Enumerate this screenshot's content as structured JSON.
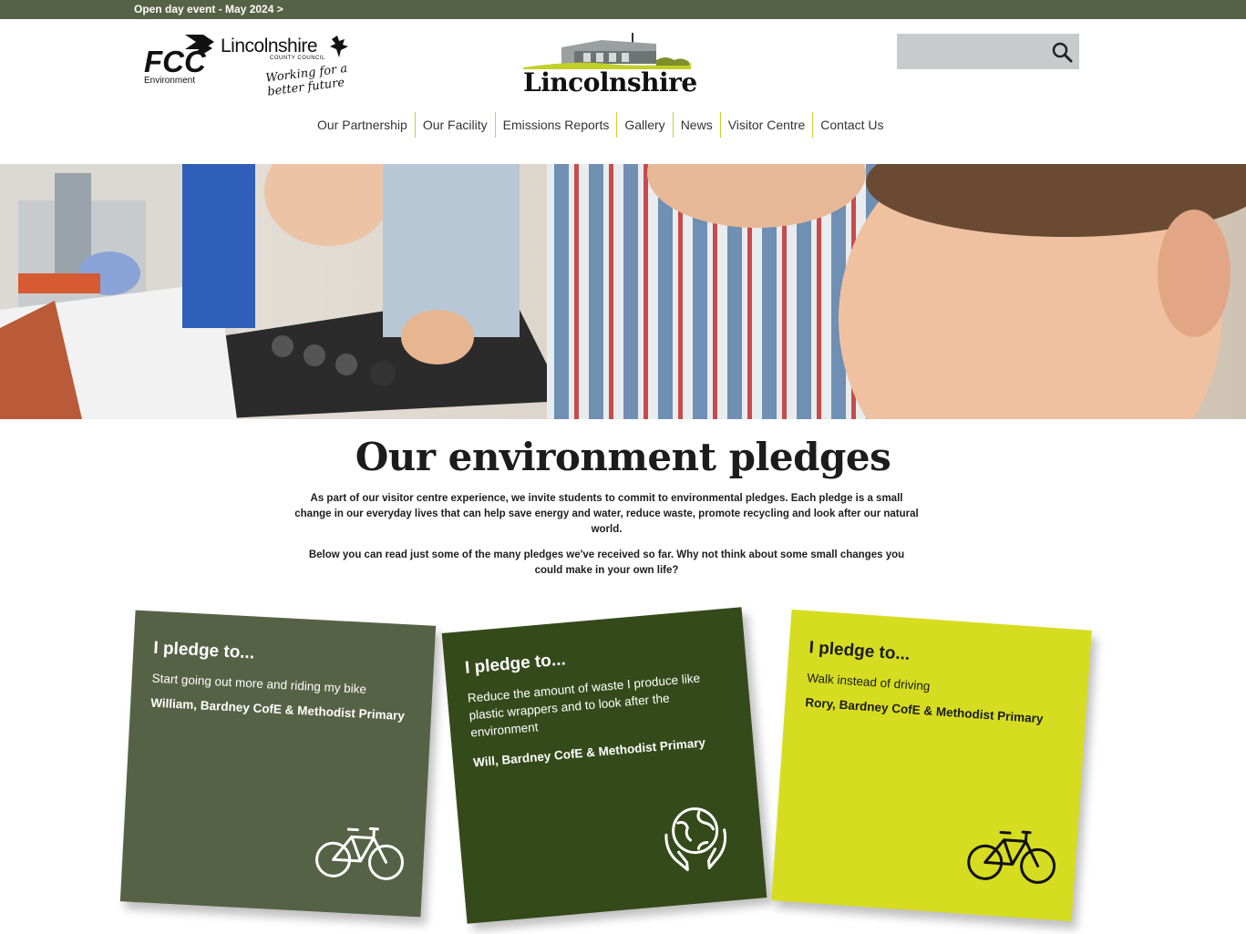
{
  "announcement": {
    "text": "Open day event - May 2024 >"
  },
  "logos": {
    "fcc_text": "FCC",
    "fcc_sub": "Environment",
    "council_name": "Lincolnshire",
    "council_sub": "COUNTY COUNCIL",
    "council_tagline": "Working for a better future",
    "site_title": "Lincolnshire"
  },
  "search": {
    "placeholder": "",
    "value": "",
    "icon": "search-icon"
  },
  "nav": {
    "items": [
      {
        "label": "Our Partnership"
      },
      {
        "label": "Our Facility"
      },
      {
        "label": "Emissions Reports"
      },
      {
        "label": "Gallery"
      },
      {
        "label": "News"
      },
      {
        "label": "Visitor Centre"
      },
      {
        "label": "Contact Us"
      }
    ],
    "divider_color": "#c7d42a"
  },
  "page": {
    "heading": "Our environment pledges",
    "intro_1": "As part of our visitor centre experience, we invite students to commit to environmental pledges. Each pledge is a small change in our everyday lives that can help save energy and water, reduce waste, promote recycling and look after our natural world.",
    "intro_2": "Below you can read just some of the many pledges we've received so far. Why not think about some small changes you could make in your own life?"
  },
  "pledges": [
    {
      "heading": "I pledge to...",
      "text": "Start going out more and riding my bike",
      "author": "William, Bardney CofE & Methodist Primary",
      "icon": "bicycle-icon",
      "color": "#566246"
    },
    {
      "heading": "I pledge to...",
      "text": "Reduce the amount of waste I produce like plastic wrappers and to look after the environment",
      "author": "Will, Bardney CofE & Methodist Primary",
      "icon": "globe-hands-icon",
      "color": "#344a1a"
    },
    {
      "heading": "I pledge to...",
      "text": "Walk instead of driving",
      "author": "Rory, Bardney CofE & Methodist Primary",
      "icon": "bicycle-icon",
      "color": "#d6dd20"
    }
  ],
  "colors": {
    "brand_green": "#566246",
    "dark_green": "#344a1a",
    "lime": "#d6dd20"
  }
}
